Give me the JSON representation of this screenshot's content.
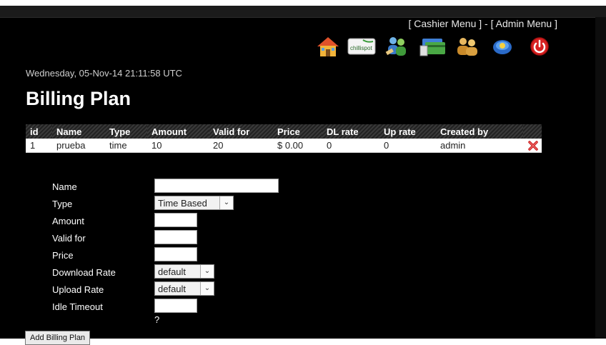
{
  "header": {
    "cashier_menu": "Cashier Menu",
    "admin_menu": "Admin Menu",
    "bracket_open": "[",
    "bracket_close": "]",
    "separator": "-"
  },
  "icons": [
    {
      "name": "home-icon"
    },
    {
      "name": "chillispot-logo",
      "text": "chillispot"
    },
    {
      "name": "users-icon"
    },
    {
      "name": "billing-cards-icon"
    },
    {
      "name": "user-group-icon"
    },
    {
      "name": "network-status-icon"
    },
    {
      "name": "power-logout-icon"
    }
  ],
  "datetime": "Wednesday, 05-Nov-14 21:11:58 UTC",
  "page_title": "Billing Plan",
  "table": {
    "headers": [
      "id",
      "Name",
      "Type",
      "Amount",
      "Valid for",
      "Price",
      "DL rate",
      "Up rate",
      "Created by"
    ],
    "rows": [
      {
        "id": "1",
        "name": "prueba",
        "type": "time",
        "amount": "10",
        "valid_for": "20",
        "price": "$ 0.00",
        "dl_rate": "0",
        "up_rate": "0",
        "created_by": "admin"
      }
    ]
  },
  "form": {
    "help": "?",
    "name_label": "Name",
    "name_value": "",
    "type_label": "Type",
    "type_selected": "Time Based",
    "amount_label": "Amount",
    "amount_value": "",
    "valid_for_label": "Valid for",
    "valid_for_value": "",
    "price_label": "Price",
    "price_value": "",
    "download_label": "Download Rate",
    "download_selected": "default",
    "upload_label": "Upload Rate",
    "upload_selected": "default",
    "idle_label": "Idle Timeout",
    "idle_value": "",
    "submit_label": "Add Billing Plan"
  },
  "colors": {
    "background": "#000000",
    "row_background": "#ffffff",
    "delete_icon": "#cc2222"
  }
}
